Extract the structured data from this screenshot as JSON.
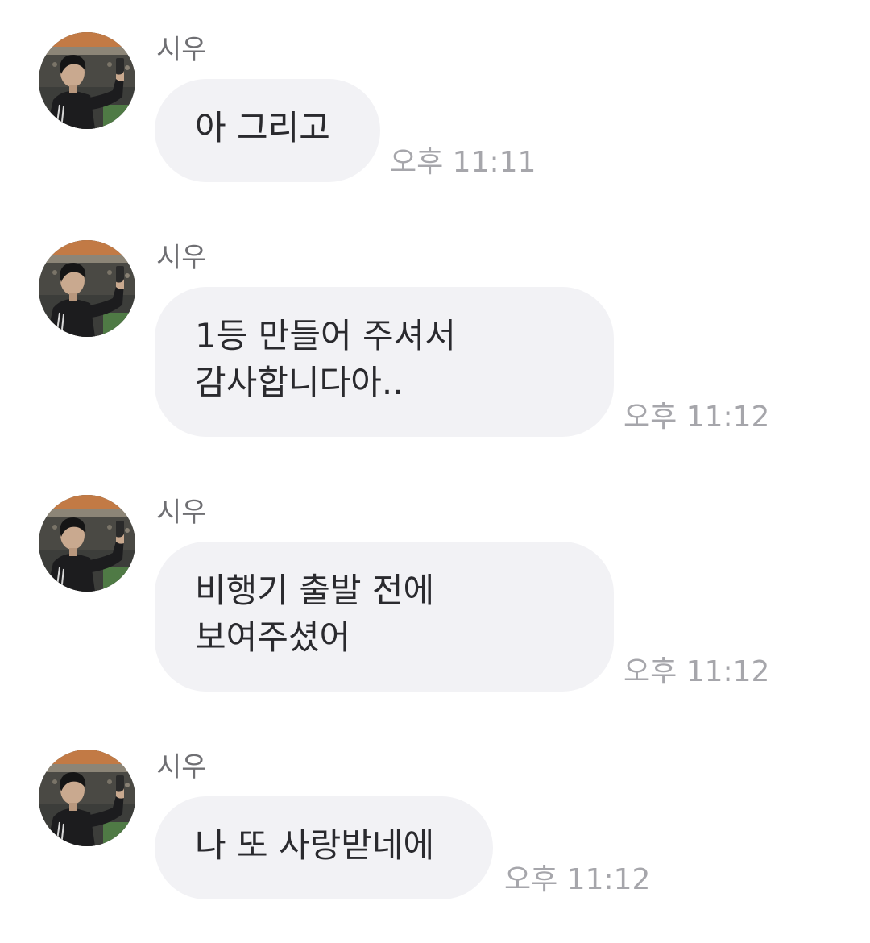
{
  "messages": [
    {
      "sender": "시우",
      "text": "아 그리고",
      "time": "오후 11:11"
    },
    {
      "sender": "시우",
      "text": "1등 만들어 주셔서\n감사합니다아..",
      "time": "오후 11:12"
    },
    {
      "sender": "시우",
      "text": "비행기 출발 전에\n보여주셨어",
      "time": "오후 11:12"
    },
    {
      "sender": "시우",
      "text": "나 또 사랑받네에",
      "time": "오후 11:12"
    }
  ],
  "colors": {
    "bubble": "#f2f2f5",
    "text": "#2a2a2e",
    "sender": "#6f6f73",
    "time": "#a6a6ab"
  },
  "icons": {
    "avatar": "profile-photo"
  }
}
